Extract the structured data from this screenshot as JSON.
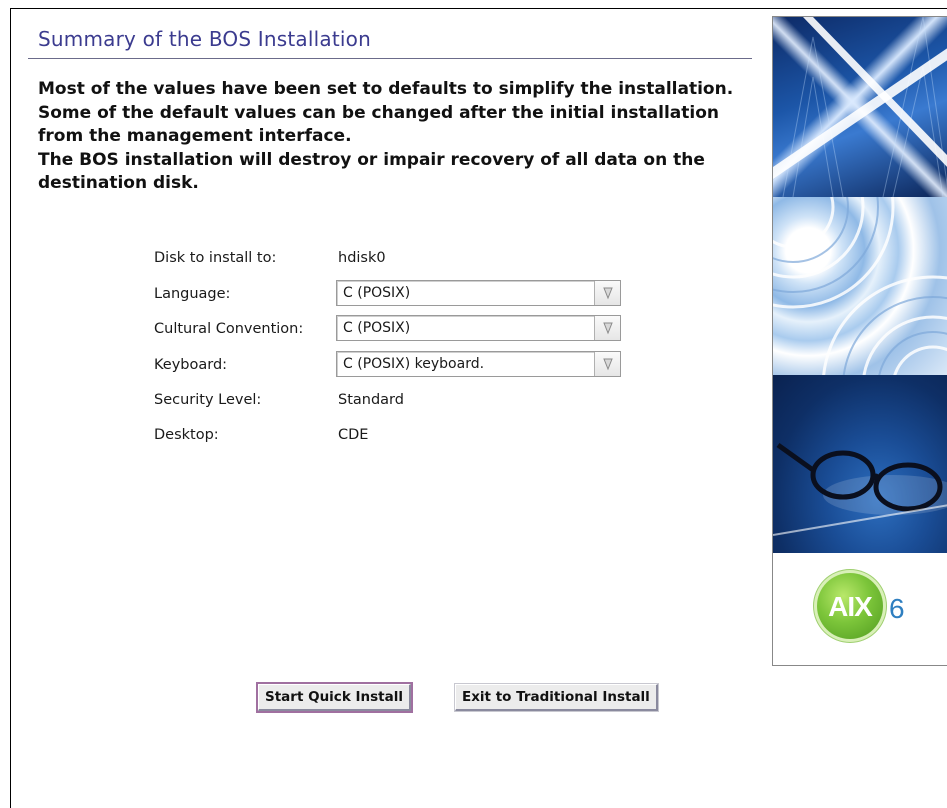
{
  "window": {
    "title": "Summary of the BOS Installation"
  },
  "intro": {
    "line1": "Most of the values have been set to defaults to simplify the installation. Some of the default values can be changed after the initial installation from the management interface.",
    "line2": "The BOS installation will destroy or impair recovery of all data on the destination disk."
  },
  "form": {
    "disk": {
      "label": "Disk to install to:",
      "value": "hdisk0"
    },
    "language": {
      "label": "Language:",
      "value": "C (POSIX)"
    },
    "cultural": {
      "label": "Cultural Convention:",
      "value": "C (POSIX)"
    },
    "keyboard": {
      "label": "Keyboard:",
      "value": "C (POSIX) keyboard."
    },
    "security": {
      "label": "Security Level:",
      "value": "Standard"
    },
    "desktop": {
      "label": "Desktop:",
      "value": "CDE"
    }
  },
  "buttons": {
    "start": "Start Quick Install",
    "exit": "Exit to Traditional Install"
  },
  "branding": {
    "logo_text": "AIX",
    "version": "6",
    "colors": {
      "title": "#3b3b8f",
      "logo_green": "#7cc53a",
      "version_blue": "#2f7fc0"
    }
  },
  "icons": {
    "combo_arrow": "chevron-down-icon"
  }
}
